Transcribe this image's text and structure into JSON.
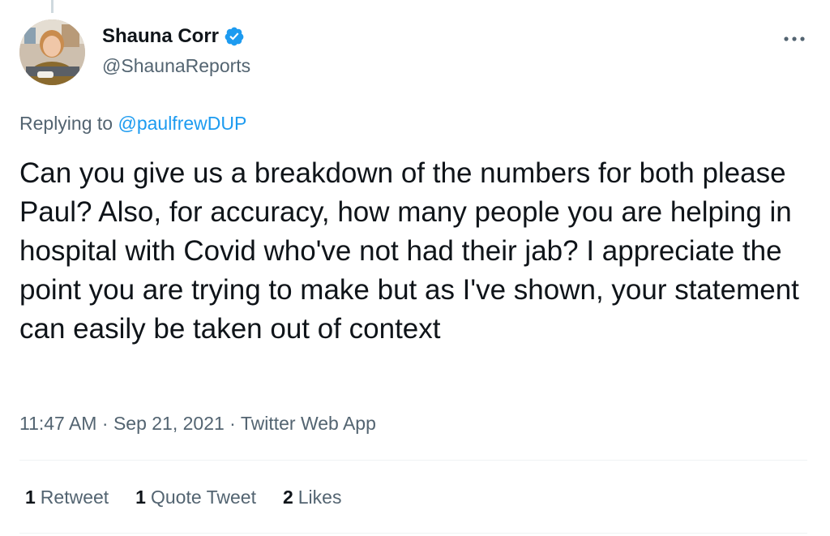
{
  "author": {
    "display_name": "Shauna Corr",
    "handle": "@ShaunaReports",
    "avatar_icon": "profile-photo",
    "verified_icon": "verified-badge-icon"
  },
  "reply": {
    "prefix": "Replying to",
    "target": "@paulfrewDUP"
  },
  "tweet": {
    "text": "Can you give us a breakdown of the numbers for both please Paul? Also, for accuracy, how many people you are helping in hospital with Covid who've not had their jab? I appreciate the point you are trying to make but as I've shown, your statement can easily be taken out of context"
  },
  "meta": {
    "time": "11:47 AM",
    "separator": "·",
    "date": "Sep 21, 2021",
    "source": "Twitter Web App"
  },
  "stats": {
    "retweets_count": "1",
    "retweets_label": "Retweet",
    "quotes_count": "1",
    "quotes_label": "Quote Tweet",
    "likes_count": "2",
    "likes_label": "Likes"
  },
  "colors": {
    "link": "#1d9bf0",
    "secondary_text": "#536471",
    "primary_text": "#0f1419"
  }
}
